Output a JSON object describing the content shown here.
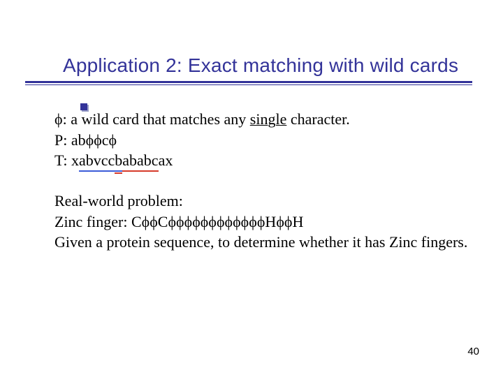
{
  "title": "Application 2: Exact matching with wild cards",
  "phi": "ϕ",
  "para1": {
    "line1_prefix": "ϕ",
    "line1_mid": ": a wild card that matches any ",
    "line1_single": "single",
    "line1_suffix": " character.",
    "line2": "P: abϕϕcϕ",
    "line3_prefix": "T: x",
    "line3_seg1": "abvcc",
    "line3_seg2_l": "b",
    "line3_seg2_r": "ababc",
    "line3_suffix": "ax"
  },
  "para2": {
    "line1": "Real-world problem:",
    "line2": "Zinc finger: CϕϕCϕϕϕϕϕϕϕϕϕϕϕϕHϕϕH",
    "line3": "Given a protein sequence, to determine whether it has Zinc fingers."
  },
  "page_number": "40",
  "colors": {
    "accent": "#333399",
    "underline_blue": "#3b5bd8",
    "underline_red": "#d63a2a"
  }
}
